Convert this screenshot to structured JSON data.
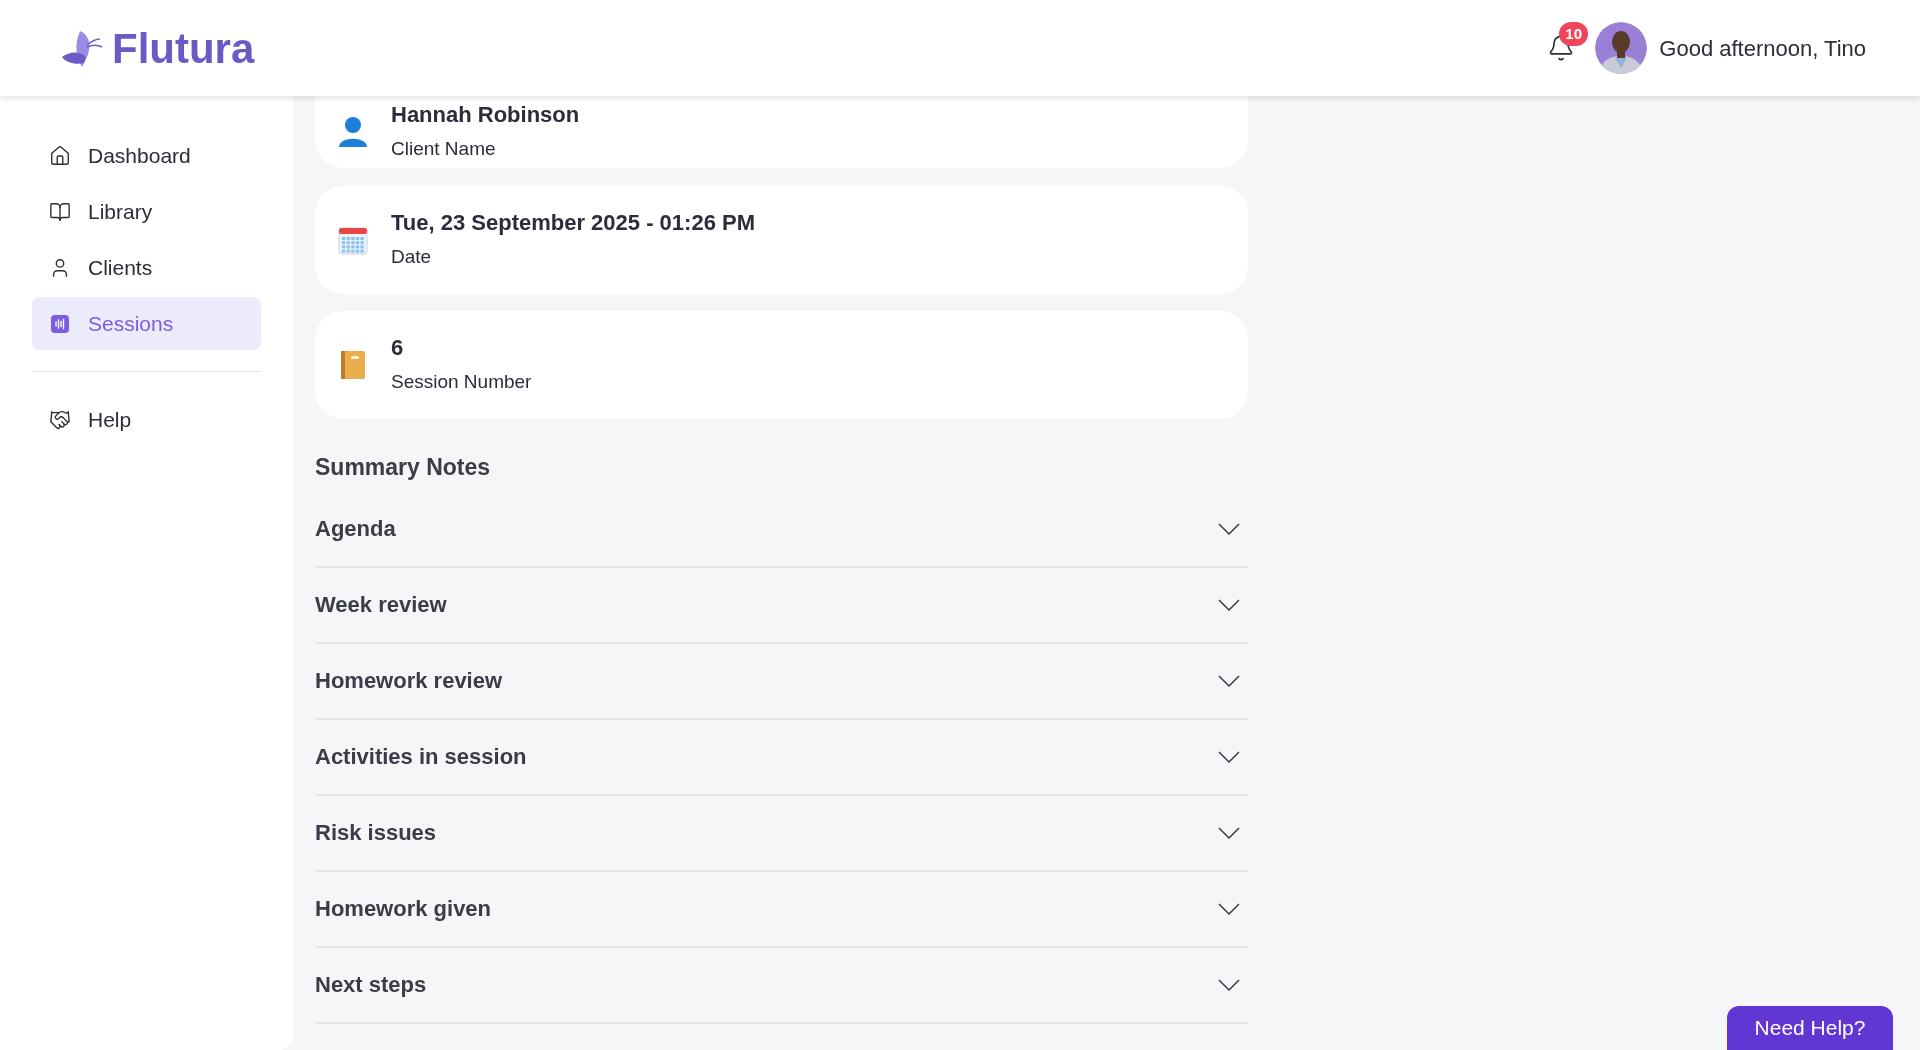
{
  "header": {
    "logo": "Flutura",
    "notification_count": "10",
    "greeting": "Good afternoon, Tino"
  },
  "sidebar": {
    "items": [
      {
        "label": "Dashboard",
        "selected": false
      },
      {
        "label": "Library",
        "selected": false
      },
      {
        "label": "Clients",
        "selected": false
      },
      {
        "label": "Sessions",
        "selected": true
      }
    ],
    "footer_items": [
      {
        "label": "Help",
        "selected": false
      }
    ]
  },
  "details": [
    {
      "kind": "client",
      "value": "Hannah Robinson",
      "label": "Client Name"
    },
    {
      "kind": "date",
      "value": "Tue, 23 September 2025 - 01:26 PM",
      "label": "Date"
    },
    {
      "kind": "session",
      "value": "6",
      "label": "Session Number"
    }
  ],
  "summary_notes": {
    "title": "Summary Notes",
    "sections": [
      {
        "title": "Agenda",
        "expanded": false
      },
      {
        "title": "Week review",
        "expanded": false
      },
      {
        "title": "Homework review",
        "expanded": false
      },
      {
        "title": "Activities in session",
        "expanded": false
      },
      {
        "title": "Risk issues",
        "expanded": false
      },
      {
        "title": "Homework given",
        "expanded": false
      },
      {
        "title": "Next steps",
        "expanded": false
      }
    ]
  },
  "help_button": "Need Help?"
}
